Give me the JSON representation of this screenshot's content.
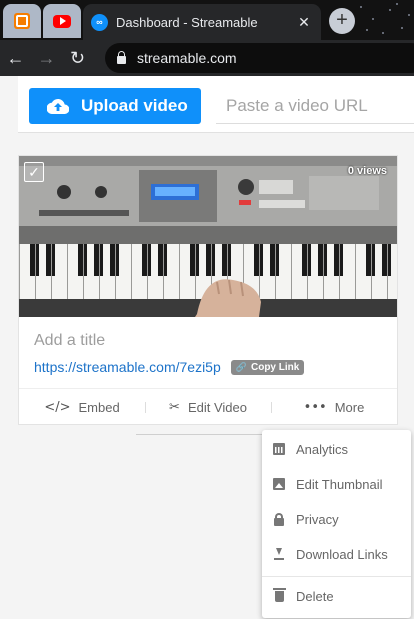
{
  "browser": {
    "pinned_tabs": [
      {
        "icon": "blogger-icon"
      },
      {
        "icon": "youtube-icon"
      }
    ],
    "active_tab": {
      "title": "Dashboard - Streamable",
      "close": "✕",
      "icon": "streamable-icon"
    },
    "new_tab": "+",
    "nav": {
      "back": "←",
      "forward": "→",
      "reload": "↻"
    },
    "url": "streamable.com"
  },
  "upload": {
    "button_label": "Upload video",
    "url_placeholder": "Paste a video URL"
  },
  "video": {
    "views": "0 views",
    "title_placeholder": "Add a title",
    "link": "https://streamable.com/7ezi5p",
    "copy_link": "Copy Link",
    "actions": [
      {
        "icon": "</>",
        "label": "Embed"
      },
      {
        "icon": "✂",
        "label": "Edit Video"
      },
      {
        "icon": "•••",
        "label": "More"
      }
    ]
  },
  "more_menu": {
    "items": [
      {
        "label": "Analytics",
        "icon": "analytics-icon"
      },
      {
        "label": "Edit Thumbnail",
        "icon": "image-icon"
      },
      {
        "label": "Privacy",
        "icon": "lock-icon"
      },
      {
        "label": "Download Links",
        "icon": "download-icon"
      },
      {
        "label": "Delete",
        "icon": "trash-icon"
      }
    ]
  },
  "colors": {
    "accent": "#0f90fa",
    "link": "#1d73c9",
    "chrome_dark": "#262729"
  }
}
